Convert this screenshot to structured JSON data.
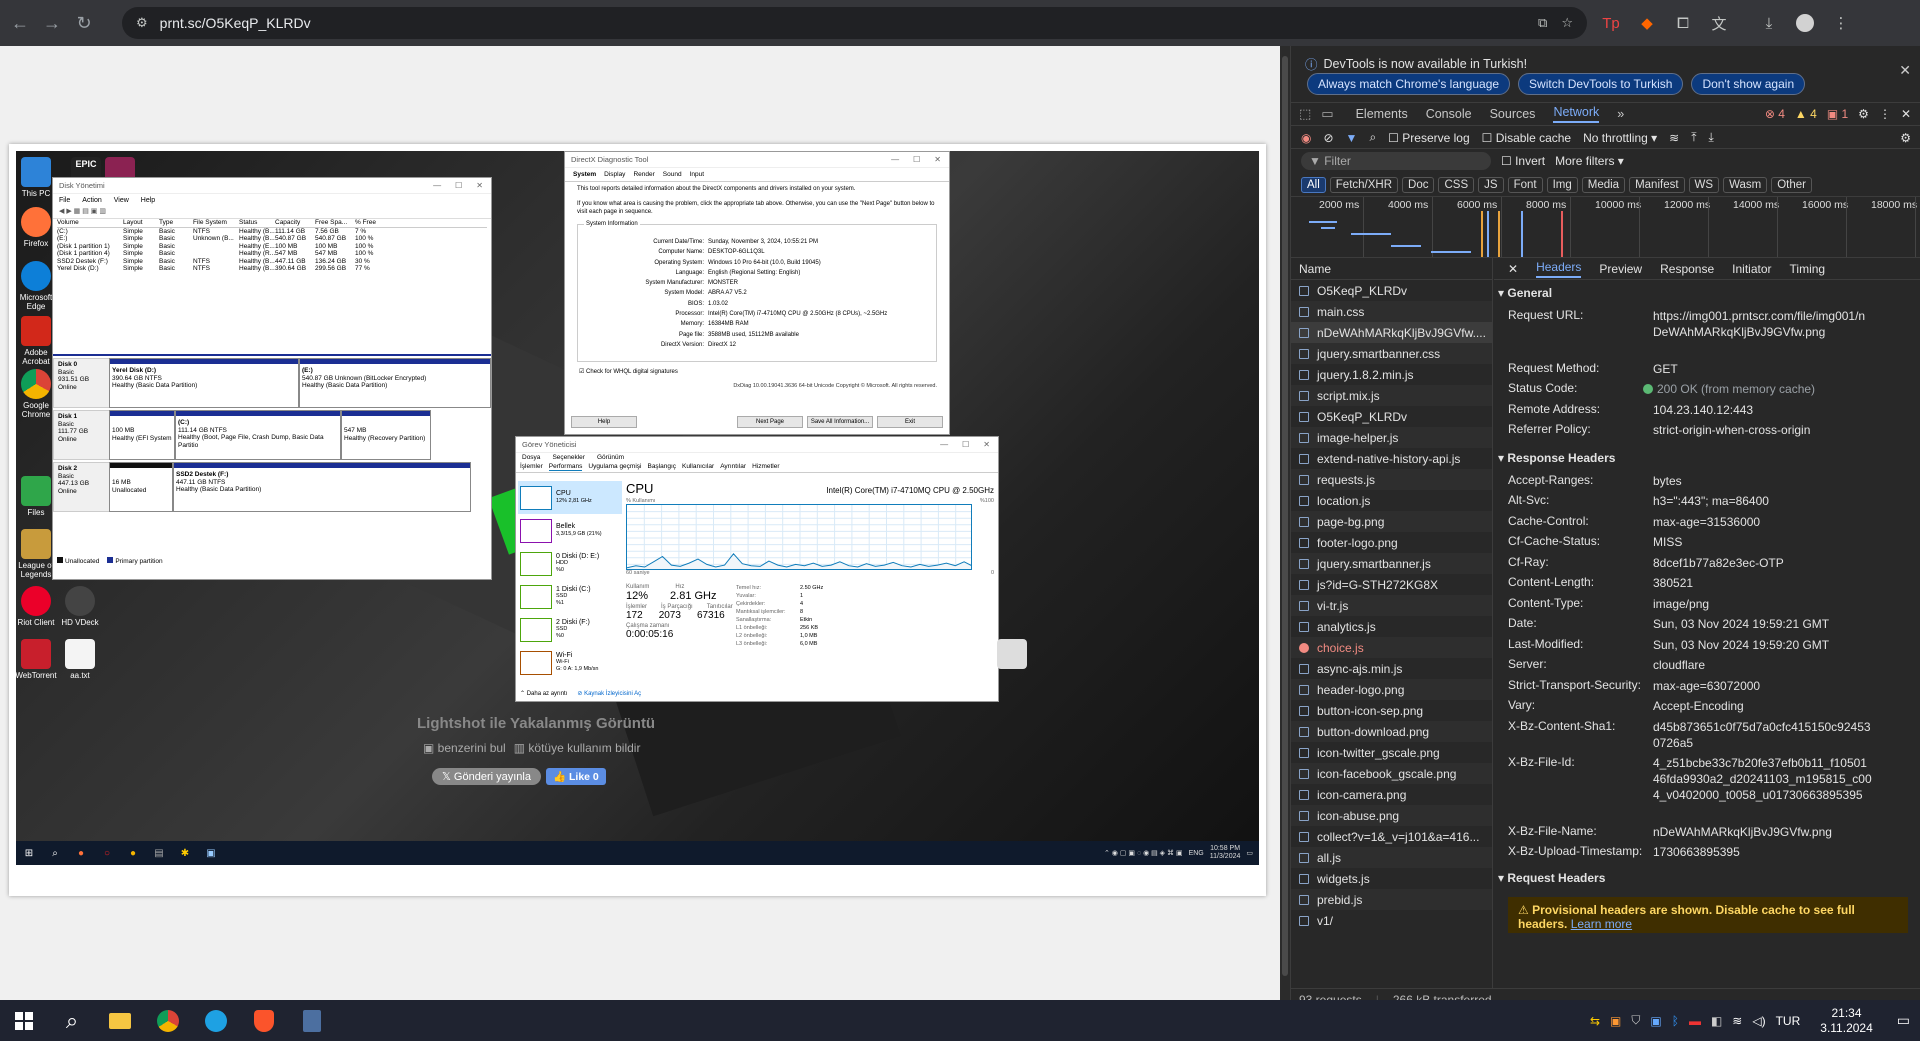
{
  "browser": {
    "url": "prnt.sc/O5KeqP_KLRDv",
    "back_icon": "arrow-left-icon",
    "accent": "#35363a"
  },
  "page": {
    "caption_title": "Lightshot ile Yakalanmış Görüntü",
    "similar_link": "benzerini bul",
    "report_link": "kötüye kullanım bildir",
    "tweet_btn": "Gönderi yayınla",
    "like_btn": "Like 0"
  },
  "screenshot": {
    "desktop_icons": [
      {
        "label": "This PC"
      },
      {
        "label": "Firefox"
      },
      {
        "label": "Microsoft Edge"
      },
      {
        "label": "Adobe Acrobat"
      },
      {
        "label": "Google Chrome"
      },
      {
        "label": "Files"
      },
      {
        "label": "League of Legends"
      },
      {
        "label": "Riot Client"
      },
      {
        "label": "HD VDeck"
      },
      {
        "label": "WebTorrent"
      },
      {
        "label": "aa.txt"
      }
    ],
    "disk_mgmt": {
      "title": "Disk Yönetimi",
      "menu": [
        "File",
        "Action",
        "View",
        "Help"
      ],
      "headers": [
        "Volume",
        "Layout",
        "Type",
        "File System",
        "Status",
        "Capacity",
        "Free Spa...",
        "% Free"
      ],
      "rows": [
        [
          "(C:)",
          "Simple",
          "Basic",
          "NTFS",
          "Healthy (B...",
          "111.14 GB",
          "7.56 GB",
          "7 %"
        ],
        [
          "(E:)",
          "Simple",
          "Basic",
          "Unknown (B...",
          "Healthy (B...",
          "540.87 GB",
          "540.87 GB",
          "100 %"
        ],
        [
          "(Disk 1 partition 1)",
          "Simple",
          "Basic",
          "",
          "Healthy (E...",
          "100 MB",
          "100 MB",
          "100 %"
        ],
        [
          "(Disk 1 partition 4)",
          "Simple",
          "Basic",
          "",
          "Healthy (R...",
          "547 MB",
          "547 MB",
          "100 %"
        ],
        [
          "SSD2 Destek (F:)",
          "Simple",
          "Basic",
          "NTFS",
          "Healthy (B...",
          "447.11 GB",
          "136.24 GB",
          "30 %"
        ],
        [
          "Yerel Disk (D:)",
          "Simple",
          "Basic",
          "NTFS",
          "Healthy (B...",
          "390.64 GB",
          "299.56 GB",
          "77 %"
        ]
      ],
      "disk0": {
        "name": "Disk 0",
        "info": [
          "Basic",
          "931.51 GB",
          "Online"
        ],
        "p1": [
          "Yerel Disk  (D:)",
          "390.64 GB NTFS",
          "Healthy (Basic Data Partition)"
        ],
        "p2": [
          "(E:)",
          "540.87 GB Unknown (BitLocker Encrypted)",
          "Healthy (Basic Data Partition)"
        ]
      },
      "disk1": {
        "name": "Disk 1",
        "info": [
          "Basic",
          "111.77 GB",
          "Online"
        ],
        "p1": [
          "100 MB",
          "Healthy (EFI System"
        ],
        "p2": [
          "(C:)",
          "111.14 GB NTFS",
          "Healthy (Boot, Page File, Crash Dump, Basic Data Partitio"
        ],
        "p3": [
          "547 MB",
          "Healthy (Recovery Partition)"
        ]
      },
      "disk2": {
        "name": "Disk 2",
        "info": [
          "Basic",
          "447.13 GB",
          "Online"
        ],
        "p1": [
          "16 MB",
          "Unallocated"
        ],
        "p2": [
          "SSD2 Destek  (F:)",
          "447.11 GB NTFS",
          "Healthy (Basic Data Partition)"
        ]
      },
      "legend": [
        "Unallocated",
        "Primary partition"
      ]
    },
    "dxdiag": {
      "title": "DirectX Diagnostic Tool",
      "tabs": [
        "System",
        "Display",
        "Render",
        "Sound",
        "Input"
      ],
      "intro1": "This tool reports detailed information about the DirectX components and drivers installed on your system.",
      "intro2": "If you know what area is causing the problem, click the appropriate tab above.  Otherwise, you can use the \"Next Page\" button below to visit each page in sequence.",
      "section": "System Information",
      "info": [
        [
          "Current Date/Time:",
          "Sunday, November 3, 2024, 10:55:21 PM"
        ],
        [
          "Computer Name:",
          "DESKTOP-6GL1Q3L"
        ],
        [
          "Operating System:",
          "Windows 10 Pro 64-bit (10.0, Build 19045)"
        ],
        [
          "Language:",
          "English (Regional Setting: English)"
        ],
        [
          "System Manufacturer:",
          "MONSTER"
        ],
        [
          "System Model:",
          "ABRA  A7 V5.2"
        ],
        [
          "BIOS:",
          "1.03.02"
        ],
        [
          "Processor:",
          "Intel(R) Core(TM) i7-4710MQ CPU @ 2.50GHz (8 CPUs), ~2.5GHz"
        ],
        [
          "Memory:",
          "16384MB RAM"
        ],
        [
          "Page file:",
          "3588MB used, 15112MB available"
        ],
        [
          "DirectX Version:",
          "DirectX 12"
        ]
      ],
      "whql": "Check for WHQL digital signatures",
      "footer": "DxDiag 10.00.19041.3636 64-bit Unicode  Copyright © Microsoft. All rights reserved.",
      "buttons": [
        "Help",
        "Next Page",
        "Save All Information...",
        "Exit"
      ]
    },
    "taskmgr": {
      "title": "Görev Yöneticisi",
      "menu": [
        "Dosya",
        "Seçenekler",
        "Görünüm"
      ],
      "tabs": [
        "İşlemler",
        "Performans",
        "Uygulama geçmişi",
        "Başlangıç",
        "Kullanıcılar",
        "Ayrıntılar",
        "Hizmetler"
      ],
      "side": [
        [
          "CPU",
          "12% 2,81 GHz"
        ],
        [
          "Bellek",
          "3,3/15,9 GB (21%)"
        ],
        [
          "0 Diski (D: E:)",
          "HDD",
          "%0"
        ],
        [
          "1 Diski (C:)",
          "SSD",
          "%1"
        ],
        [
          "2 Diski (F:)",
          "SSD",
          "%0"
        ],
        [
          "Wi-Fi",
          "Wi-Fi",
          "G: 0 A: 1,9 Mb/sn"
        ]
      ],
      "cpu_title": "CPU",
      "cpu_name": "Intel(R) Core(TM) i7-4710MQ CPU @ 2.50GHz",
      "graph_label": "% Kullanımı",
      "graph_max": "%100",
      "graph_time": "60 saniye",
      "graph_min": "0",
      "stats": {
        "usage_l": "Kullanım",
        "usage": "12%",
        "speed_l": "Hız",
        "speed": "2.81 GHz",
        "proc_l": "İşlemler",
        "proc": "172",
        "thr_l": "İş Parçacığı",
        "thr": "2073",
        "handles_l": "Tanıtıcılar",
        "handles": "67316",
        "uptime_l": "Çalışma zamanı",
        "uptime": "0:00:05:16"
      },
      "right": [
        [
          "Temel hız:",
          "2.50 GHz"
        ],
        [
          "Yuvalar:",
          "1"
        ],
        [
          "Çekirdekler:",
          "4"
        ],
        [
          "Mantıksal işlemciler:",
          "8"
        ],
        [
          "Sanallaştırma:",
          "Etkin"
        ],
        [
          "L1 önbelleği:",
          "256 KB"
        ],
        [
          "L2 önbelleği:",
          "1,0 MB"
        ],
        [
          "L3 önbelleği:",
          "6,0 MB"
        ]
      ],
      "less": "Daha az ayrıntı",
      "resmon": "Kaynak İzleyicisini Aç",
      "cpu_graph": [
        5,
        8,
        6,
        14,
        22,
        9,
        7,
        12,
        18,
        10,
        6,
        9,
        26,
        11,
        8,
        7,
        15,
        9,
        6,
        10,
        8,
        12,
        7,
        9,
        14,
        8,
        6,
        11,
        7,
        9,
        13,
        8,
        6,
        10,
        7,
        9,
        12,
        8,
        14,
        7
      ],
      "graph_color": "#117dbb"
    },
    "tray": {
      "lang": "ENG",
      "time": "10:58 PM",
      "date": "11/3/2024"
    }
  },
  "devtools": {
    "notice": "DevTools is now available in Turkish!",
    "btn_match": "Always match Chrome's language",
    "btn_switch": "Switch DevTools to Turkish",
    "btn_dont": "Don't show again",
    "tabs": [
      "Elements",
      "Console",
      "Sources",
      "Network"
    ],
    "active_tab": "Network",
    "errors": "4",
    "warnings": "4",
    "info": "1",
    "filter_placeholder": "Filter",
    "preserve_log": "Preserve log",
    "disable_cache": "Disable cache",
    "throttle": "No throttling",
    "invert": "Invert",
    "more_filters": "More filters",
    "type_filters": [
      "All",
      "Fetch/XHR",
      "Doc",
      "CSS",
      "JS",
      "Font",
      "Img",
      "Media",
      "Manifest",
      "WS",
      "Wasm",
      "Other"
    ],
    "timeline": [
      "2000 ms",
      "4000 ms",
      "6000 ms",
      "8000 ms",
      "10000 ms",
      "12000 ms",
      "14000 ms",
      "16000 ms",
      "18000 ms"
    ],
    "name_header": "Name",
    "requests": [
      "O5KeqP_KLRDv",
      "main.css",
      "nDeWAhMARkqKljBvJ9GVfw....",
      "jquery.smartbanner.css",
      "jquery.1.8.2.min.js",
      "script.mix.js",
      "O5KeqP_KLRDv",
      "image-helper.js",
      "extend-native-history-api.js",
      "requests.js",
      "location.js",
      "page-bg.png",
      "footer-logo.png",
      "jquery.smartbanner.js",
      "js?id=G-STH272KG8X",
      "vi-tr.js",
      "analytics.js",
      "choice.js",
      "async-ajs.min.js",
      "header-logo.png",
      "button-icon-sep.png",
      "button-download.png",
      "icon-twitter_gscale.png",
      "icon-facebook_gscale.png",
      "icon-camera.png",
      "icon-abuse.png",
      "collect?v=1&_v=j101&a=416...",
      "all.js",
      "widgets.js",
      "prebid.js",
      "v1/"
    ],
    "detail_tabs": [
      "Headers",
      "Preview",
      "Response",
      "Initiator",
      "Timing"
    ],
    "general_title": "General",
    "general": [
      [
        "Request URL:",
        "https://img001.prntscr.com/file/img001/nDeWAhMARkqKljBvJ9GVfw.png"
      ],
      [
        "Request Method:",
        "GET"
      ],
      [
        "Status Code:",
        "200 OK (from memory cache)"
      ],
      [
        "Remote Address:",
        "104.23.140.12:443"
      ],
      [
        "Referrer Policy:",
        "strict-origin-when-cross-origin"
      ]
    ],
    "response_title": "Response Headers",
    "response": [
      [
        "Accept-Ranges:",
        "bytes"
      ],
      [
        "Alt-Svc:",
        "h3=\":443\"; ma=86400"
      ],
      [
        "Cache-Control:",
        "max-age=31536000"
      ],
      [
        "Cf-Cache-Status:",
        "MISS"
      ],
      [
        "Cf-Ray:",
        "8dcef1b77a82e3ec-OTP"
      ],
      [
        "Content-Length:",
        "380521"
      ],
      [
        "Content-Type:",
        "image/png"
      ],
      [
        "Date:",
        "Sun, 03 Nov 2024 19:59:21 GMT"
      ],
      [
        "Last-Modified:",
        "Sun, 03 Nov 2024 19:59:20 GMT"
      ],
      [
        "Server:",
        "cloudflare"
      ],
      [
        "Strict-Transport-Security:",
        "max-age=63072000"
      ],
      [
        "Vary:",
        "Accept-Encoding"
      ],
      [
        "X-Bz-Content-Sha1:",
        "d45b873651c0f75d7a0cfc415150c924530726a5"
      ],
      [
        "X-Bz-File-Id:",
        "4_z51bcbe33c7b20fe37efb0b11_f1050146fda9930a2_d20241103_m195815_c004_v0402000_t0058_u01730663895395"
      ],
      [
        "X-Bz-File-Name:",
        "nDeWAhMARkqKljBvJ9GVfw.png"
      ],
      [
        "X-Bz-Upload-Timestamp:",
        "1730663895395"
      ]
    ],
    "request_title": "Request Headers",
    "provisional": "Provisional headers are shown. Disable cache to see full headers.",
    "learn_more": "Learn more",
    "summary_requests": "93 requests",
    "summary_transferred": "266 kB transferred"
  },
  "taskbar": {
    "lang": "TUR",
    "time": "21:34",
    "date": "3.11.2024"
  }
}
